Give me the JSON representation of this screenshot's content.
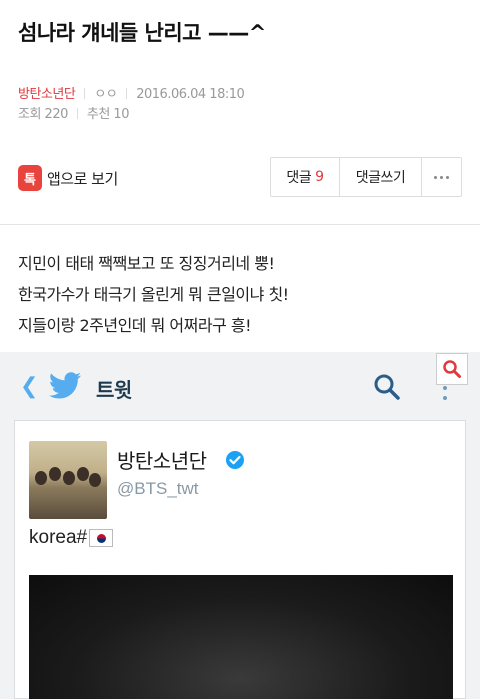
{
  "post": {
    "title": "섬나라 걔네들 난리고 ——^",
    "board": "방탄소년단",
    "author": "ㅇㅇ",
    "date": "2016.06.04 18:10",
    "views": "조회 220",
    "recommends": "추천 10"
  },
  "toolbar": {
    "app_icon_glyph": "톡",
    "app_view_label": "앱으로 보기",
    "comments_label": "댓글",
    "comments_count": "9",
    "write_comment_label": "댓글쓰기"
  },
  "body": {
    "lines": [
      "지민이 태태 짹짹보고 또 징징거리네 뿡!",
      "한국가수가 태극기 올린게 뭐 큰일이냐 칫!",
      "지들이랑 2주년인데 뭐 어쩌라구 흥!"
    ]
  },
  "screenshot": {
    "nav_title": "트윗",
    "tweet": {
      "name": "방탄소년단",
      "handle": "@BTS_twt",
      "text": "korea#"
    }
  },
  "colors": {
    "accent_red": "#e0393e",
    "twitter_blue": "#55acee",
    "verified_blue": "#1da1f2"
  }
}
